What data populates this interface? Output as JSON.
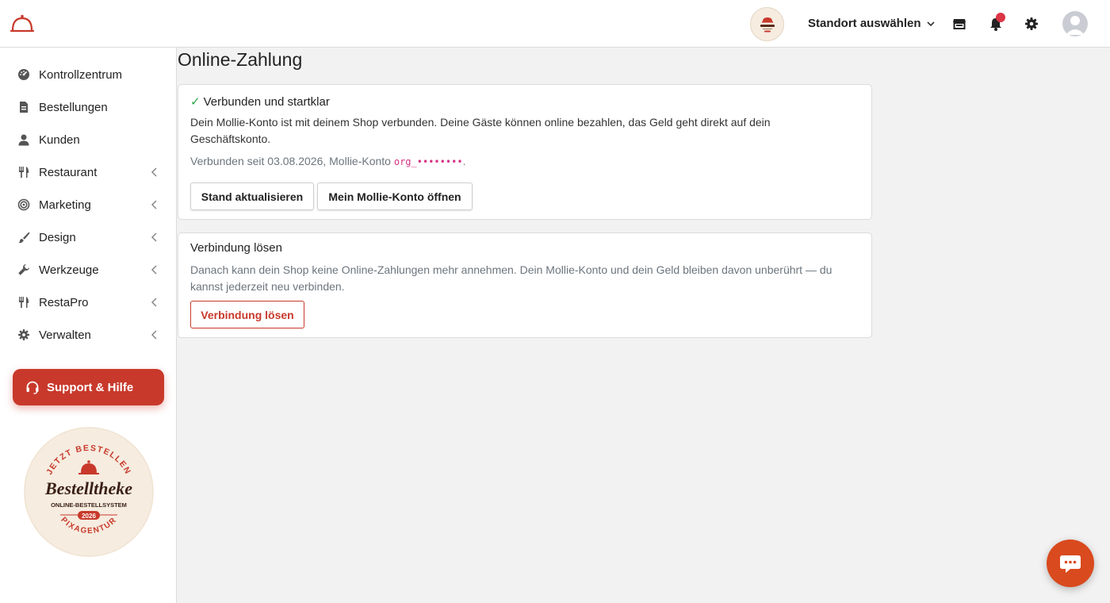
{
  "header": {
    "location_label": "Standort auswählen",
    "logo_text": "Bestelltheke"
  },
  "sidebar": {
    "items": [
      {
        "label": "Kontrollzentrum",
        "icon": "dashboard-icon",
        "has_submenu": false
      },
      {
        "label": "Bestellungen",
        "icon": "receipt-icon",
        "has_submenu": false
      },
      {
        "label": "Kunden",
        "icon": "user-icon",
        "has_submenu": false
      },
      {
        "label": "Restaurant",
        "icon": "utensils-icon",
        "has_submenu": true
      },
      {
        "label": "Marketing",
        "icon": "target-icon",
        "has_submenu": true
      },
      {
        "label": "Design",
        "icon": "brush-icon",
        "has_submenu": true
      },
      {
        "label": "Werkzeuge",
        "icon": "wrench-icon",
        "has_submenu": true
      },
      {
        "label": "RestaPro",
        "icon": "utensils-icon",
        "has_submenu": true
      },
      {
        "label": "Verwalten",
        "icon": "gear-icon",
        "has_submenu": true
      }
    ],
    "support_label": "Support & Hilfe",
    "badge": {
      "top_text": "JETZT BESTELLEN",
      "brand": "Bestelltheke",
      "subtitle": "ONLINE-BESTELLSYSTEM",
      "year": "2026",
      "bottom_text": "PIXAGENTUR"
    }
  },
  "main": {
    "title": "Online-Zahlung",
    "connected_card": {
      "title": "Verbunden und startklar",
      "description": "Dein Mollie-Konto ist mit deinem Shop verbunden. Deine Gäste können online bezahlen, das Geld geht direkt auf dein Geschäftskonto.",
      "since_prefix": "Verbunden seit 03.08.2026, Mollie-Konto ",
      "account_code": "org_••••••••",
      "since_suffix": ".",
      "refresh_label": "Stand aktualisieren",
      "open_label": "Mein Mollie-Konto öffnen"
    },
    "disconnect_card": {
      "title": "Verbindung lösen",
      "description": "Danach kann dein Shop keine Online-Zahlungen mehr annehmen. Dein Mollie-Konto und dein Geld bleiben davon unberührt — du kannst jederzeit neu verbinden.",
      "disconnect_label": "Verbindung lösen"
    }
  },
  "colors": {
    "accent": "#c8392b",
    "success": "#28a745",
    "chat": "#d94a1e",
    "background": "#f2f2f2"
  }
}
